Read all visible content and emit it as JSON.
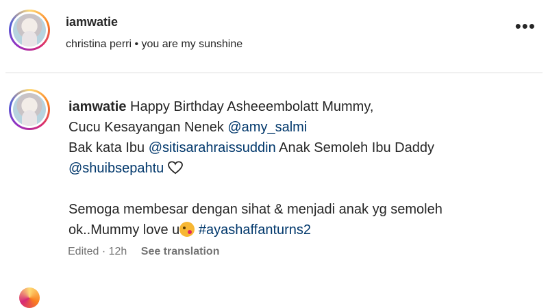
{
  "post": {
    "username": "iamwatie",
    "music": "christina perri • you are my sunshine",
    "more_label": "•••"
  },
  "comment": {
    "username": "iamwatie",
    "line1": "Happy Birthday Asheeembolatt Mummy,",
    "line2_text": "Cucu Kesayangan Nenek ",
    "line2_mention": "@amy_salmi",
    "line3_text": "Bak kata Ibu ",
    "line3_mention": "@sitisarahraissuddin",
    "line3_after": " Anak Semoleh Ibu Daddy",
    "line4_mention": "@shuibsepahtu",
    "line5": "Semoga membesar dengan sihat & menjadi anak yg semoleh",
    "line6_text": "ok..Mummy love u",
    "line6_hashtag": "#ayashaffanturns2",
    "edited": "Edited",
    "time": "12h",
    "see_translation": "See translation"
  },
  "icons": {
    "heart": "heart-outline-icon",
    "emoji": "face-blowing-kiss-icon"
  }
}
